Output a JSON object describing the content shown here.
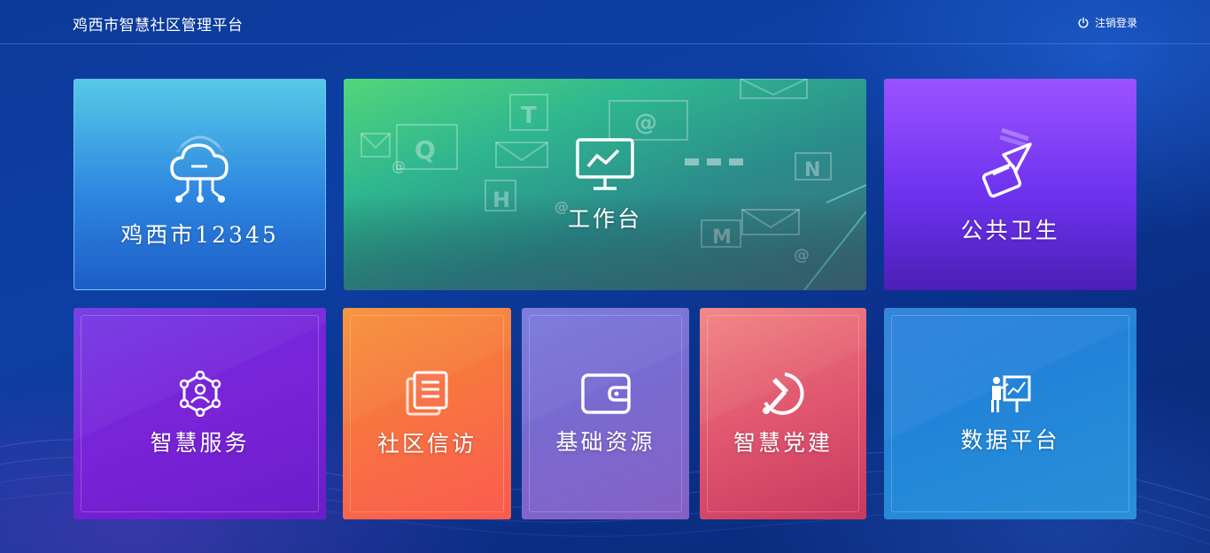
{
  "header": {
    "title": "鸡西市智慧社区管理平台",
    "logout_label": "注销登录"
  },
  "tiles": {
    "hotline": {
      "label": "鸡西市12345",
      "icon": "cloud-network-icon"
    },
    "workbench": {
      "label": "工作台",
      "icon": "monitor-chart-icon"
    },
    "public_health": {
      "label": "公共卫生",
      "icon": "spray-bottle-icon"
    },
    "smart_service": {
      "label": "智慧服务",
      "icon": "user-network-icon"
    },
    "community_letters": {
      "label": "社区信访",
      "icon": "documents-icon"
    },
    "basic_resources": {
      "label": "基础资源",
      "icon": "wallet-icon"
    },
    "smart_party": {
      "label": "智慧党建",
      "icon": "hammer-sickle-icon"
    },
    "data_platform": {
      "label": "数据平台",
      "icon": "presentation-icon"
    }
  },
  "colors": {
    "background": "#0d3fa3",
    "hotline": "#2e86e0",
    "workbench": "#2fb68f",
    "public_health": "#6d32ee",
    "smart_service": "#7a23d8",
    "community_letters": "#f86e45",
    "basic_resources": "#7a6ad0",
    "smart_party": "#e0576f",
    "data_platform": "#2488d8"
  }
}
